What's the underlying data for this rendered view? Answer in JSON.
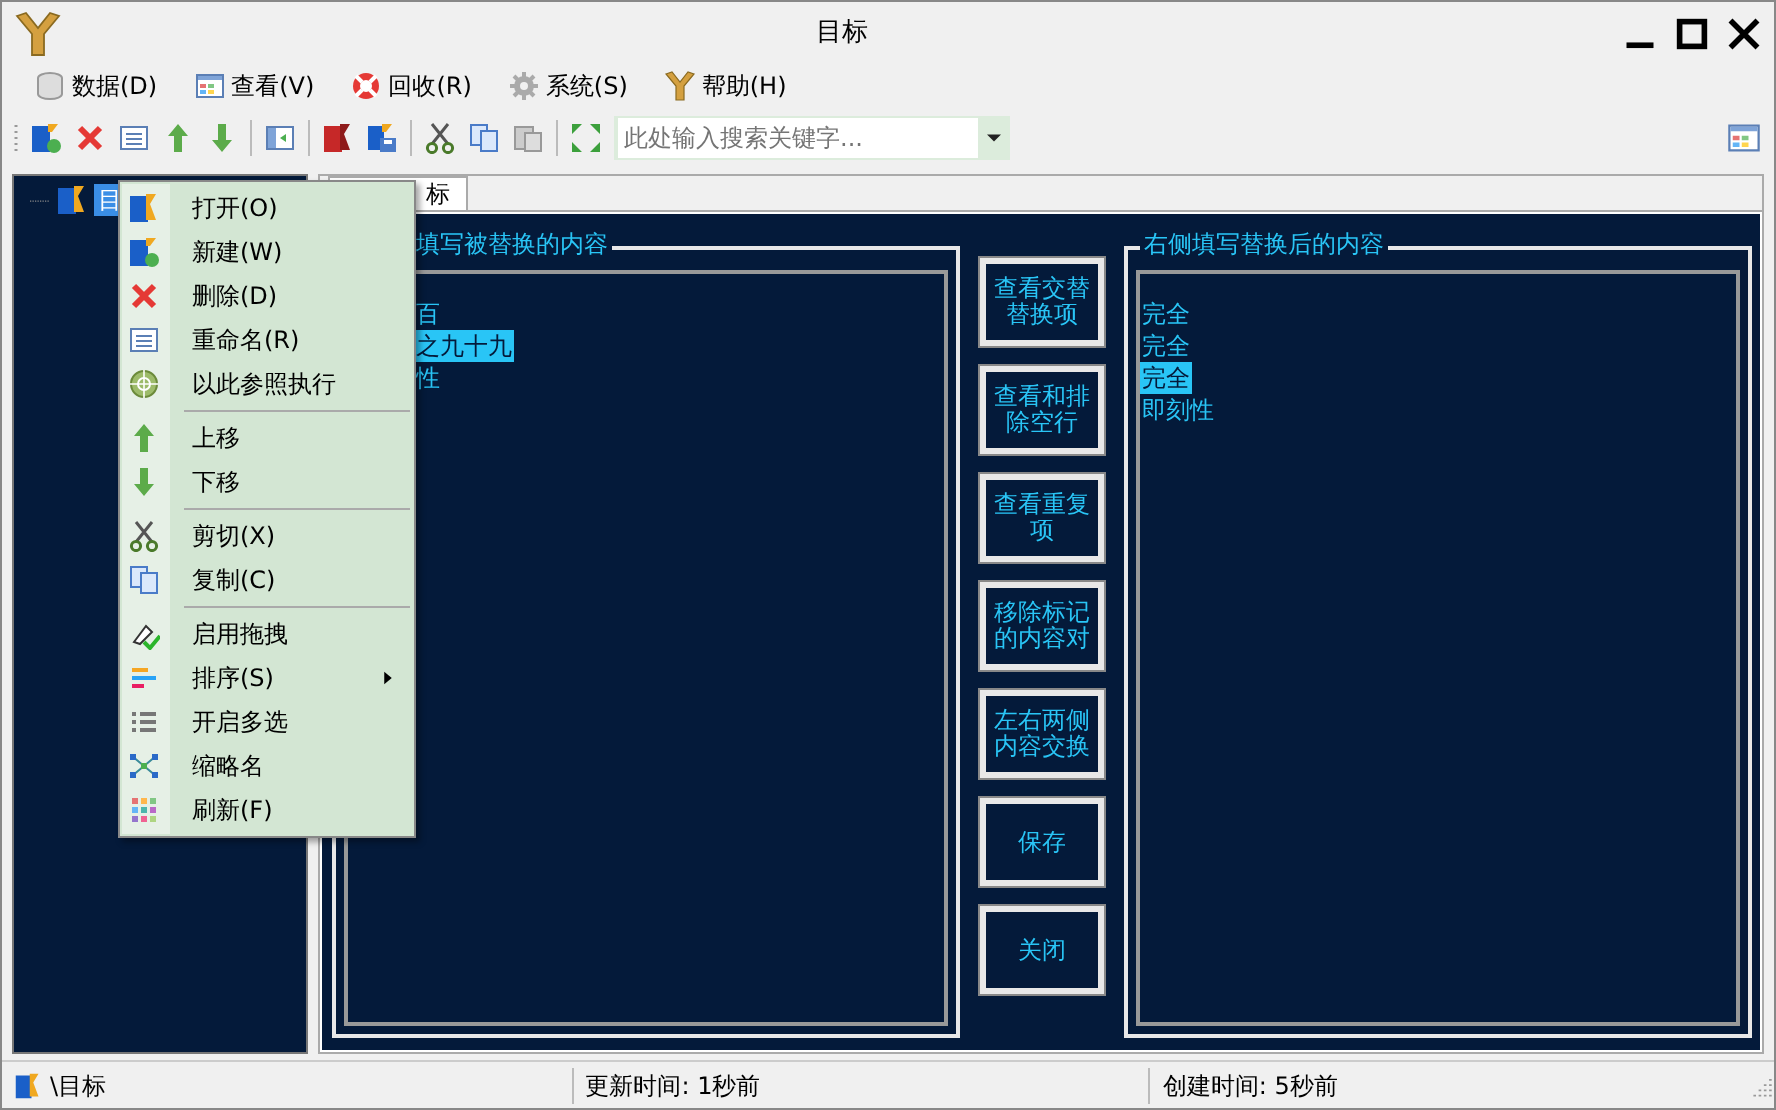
{
  "window": {
    "title": "目标"
  },
  "menu_bar": [
    {
      "label": "数据(D)"
    },
    {
      "label": "查看(V)"
    },
    {
      "label": "回收(R)"
    },
    {
      "label": "系统(S)"
    },
    {
      "label": "帮助(H)"
    }
  ],
  "toolbar": {
    "search": {
      "placeholder": "此处输入搜索关键字..."
    }
  },
  "tree": [
    {
      "label": "目",
      "selected": true
    }
  ],
  "tabs": [
    {
      "label": "标",
      "selected": true
    }
  ],
  "left_group": {
    "title": "填写被替换的内容",
    "items": [
      {
        "text": "百",
        "selected": false
      },
      {
        "text": "之九十九",
        "selected": true
      },
      {
        "text": "性",
        "selected": false
      }
    ]
  },
  "buttons": [
    "查看交替替换项",
    "查看和排除空行",
    "查看重复项",
    "移除标记的内容对",
    "左右两侧内容交换",
    "保存",
    "关闭"
  ],
  "right_group": {
    "title": "右侧填写替换后的内容",
    "items": [
      {
        "text": "完全",
        "selected": false
      },
      {
        "text": "完全",
        "selected": false
      },
      {
        "text": "完全",
        "selected": true
      },
      {
        "text": "即刻性",
        "selected": false
      }
    ]
  },
  "context_menu": {
    "groups": [
      [
        {
          "label": "打开(O)",
          "submenu": false
        },
        {
          "label": "新建(W)",
          "submenu": false
        },
        {
          "label": "删除(D)",
          "submenu": false
        },
        {
          "label": "重命名(R)",
          "submenu": false
        },
        {
          "label": "以此参照执行",
          "submenu": false
        }
      ],
      [
        {
          "label": "上移",
          "submenu": false
        },
        {
          "label": "下移",
          "submenu": false
        }
      ],
      [
        {
          "label": "剪切(X)",
          "submenu": false
        },
        {
          "label": "复制(C)",
          "submenu": false
        }
      ],
      [
        {
          "label": "启用拖拽",
          "submenu": false
        },
        {
          "label": "排序(S)",
          "submenu": true
        },
        {
          "label": "开启多选",
          "submenu": false
        },
        {
          "label": "缩略名",
          "submenu": false
        },
        {
          "label": "刷新(F)",
          "submenu": false
        }
      ]
    ]
  },
  "status_bar": [
    "\\目标",
    "更新时间: 1秒前",
    "创建时间: 5秒前"
  ]
}
